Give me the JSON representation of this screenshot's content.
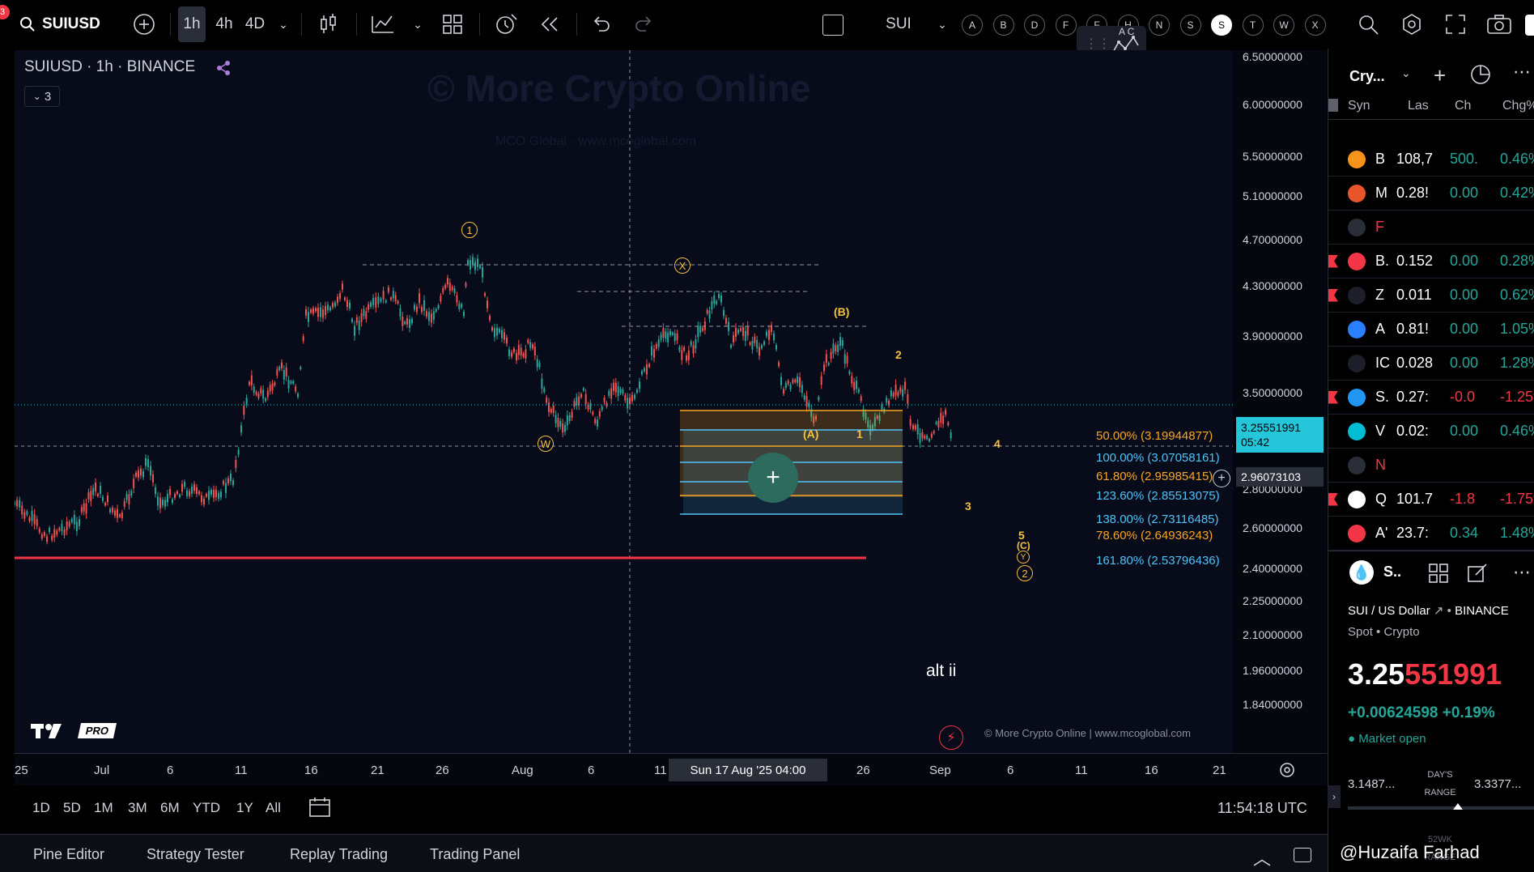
{
  "toolbar": {
    "notification_count": "3",
    "symbol": "SUIUSD",
    "timeframes": [
      "1h",
      "4h",
      "4D"
    ],
    "active_timeframe": "1h",
    "symbol_compare": "SUI",
    "letters": [
      "A",
      "B",
      "D",
      "F",
      "F",
      "H",
      "N",
      "S",
      "S",
      "T",
      "W",
      "X"
    ],
    "active_letter_index": 8,
    "drawing_overlay": "A C"
  },
  "chart": {
    "title": "SUIUSD · 1h · BINANCE",
    "indicators_count": "3",
    "watermark_main": "© More Crypto Online",
    "watermark_sub": "MCO Global   ·   www.mcoglobal.com",
    "footer_credit": "© More Crypto Online  |  www.mcoglobal.com",
    "alt_label": "alt ii",
    "logo_text": "PRO",
    "annotations": {
      "w1": "1",
      "wx": "X",
      "wb": "(B)",
      "w2": "2",
      "ww": "W",
      "wa": "(A)",
      "n1": "1",
      "n4": "4",
      "n3": "3",
      "n5": "5",
      "wc": "(C)",
      "wy": "Y",
      "w2b": "2"
    },
    "fib_levels": [
      {
        "label": "50.00% (3.19944877)",
        "color": "#f5a623"
      },
      {
        "label": "100.00% (3.07058161)",
        "color": "#4fc3f7"
      },
      {
        "label": "61.80% (2.95985415)",
        "color": "#f5a623"
      },
      {
        "label": "123.60% (2.85513075)",
        "color": "#4fc3f7"
      },
      {
        "label": "138.00% (2.73116485)",
        "color": "#4fc3f7"
      },
      {
        "label": "78.60% (2.64936243)",
        "color": "#f5a623"
      },
      {
        "label": "161.80% (2.53796436)",
        "color": "#4fc3f7"
      }
    ]
  },
  "price_axis": {
    "labels": [
      "6.50000000",
      "6.00000000",
      "5.50000000",
      "5.10000000",
      "4.70000000",
      "4.30000000",
      "3.90000000",
      "3.50000000",
      "2.80000000",
      "2.60000000",
      "2.40000000",
      "2.25000000",
      "2.10000000",
      "1.96000000",
      "1.84000000"
    ],
    "current_price": "3.25551991",
    "countdown": "05:42",
    "crosshair_price": "2.96073103"
  },
  "time_axis": {
    "labels": [
      "25",
      "Jul",
      "6",
      "11",
      "16",
      "21",
      "26",
      "Aug",
      "6",
      "11",
      "26",
      "Sep",
      "6",
      "11",
      "16",
      "21"
    ],
    "crosshair_time": "Sun 17 Aug '25   04:00"
  },
  "range_bar": {
    "ranges": [
      "1D",
      "5D",
      "1M",
      "3M",
      "6M",
      "YTD",
      "1Y",
      "All"
    ],
    "clock": "11:54:18 UTC"
  },
  "bottom_tabs": [
    "Pine Editor",
    "Strategy Tester",
    "Replay Trading",
    "Trading Panel"
  ],
  "watchlist": {
    "title": "Cry...",
    "columns": [
      "Syn",
      "Las",
      "Ch",
      "Chg%"
    ],
    "rows": [
      {
        "sym": "B",
        "last": "108,7",
        "chg": "500.",
        "pct": "0.46%",
        "icon_color": "#f7931a",
        "flag": false,
        "chg_color": "#26a69a"
      },
      {
        "sym": "M",
        "last": "0.28!",
        "chg": "0.00",
        "pct": "0.42%",
        "icon_color": "#e8552a",
        "flag": false,
        "chg_color": "#26a69a"
      },
      {
        "sym": "F",
        "last": "",
        "chg": "",
        "pct": "",
        "icon_color": "#2a2e39",
        "flag": false,
        "chg_color": "#f23645"
      },
      {
        "sym": "B.",
        "last": "0.152",
        "chg": "0.00",
        "pct": "0.28%",
        "icon_color": "#f23645",
        "flag": true,
        "chg_color": "#26a69a"
      },
      {
        "sym": "Z",
        "last": "0.011",
        "chg": "0.00",
        "pct": "0.62%",
        "icon_color": "#1c1f29",
        "flag": true,
        "chg_color": "#26a69a"
      },
      {
        "sym": "A",
        "last": "0.81!",
        "chg": "0.00",
        "pct": "1.05%",
        "icon_color": "#2a7fff",
        "flag": false,
        "chg_color": "#26a69a"
      },
      {
        "sym": "IC",
        "last": "0.028",
        "chg": "0.00",
        "pct": "1.28%",
        "icon_color": "#1c1f29",
        "flag": false,
        "chg_color": "#26a69a"
      },
      {
        "sym": "S.",
        "last": "0.27:",
        "chg": "-0.0",
        "pct": "-1.25%",
        "icon_color": "#2196f3",
        "flag": true,
        "chg_color": "#f23645"
      },
      {
        "sym": "V",
        "last": "0.02:",
        "chg": "0.00",
        "pct": "0.46%",
        "icon_color": "#00bcd4",
        "flag": false,
        "chg_color": "#26a69a"
      },
      {
        "sym": "N",
        "last": "",
        "chg": "",
        "pct": "",
        "icon_color": "#2a2e39",
        "flag": false,
        "chg_color": "#f23645"
      },
      {
        "sym": "Q",
        "last": "101.7",
        "chg": "-1.8",
        "pct": "-1.75%",
        "icon_color": "#ffffff",
        "flag": true,
        "chg_color": "#f23645"
      },
      {
        "sym": "A'",
        "last": "23.7:",
        "chg": "0.34",
        "pct": "1.48%",
        "icon_color": "#f23645",
        "flag": false,
        "chg_color": "#26a69a"
      }
    ]
  },
  "details": {
    "symbol_short": "S..",
    "name": "SUI / US Dollar",
    "exchange": "BINANCE",
    "type": "Spot • Crypto",
    "price_main": "3.25",
    "price_tail": "551991",
    "change": "+0.00624598",
    "change_pct": "+0.19%",
    "market_status": "Market open",
    "range_low": "3.1487...",
    "range_label": "DAY'S RANGE",
    "range_high": "3.3377...",
    "week52_label": "52WK RANGE",
    "watermark_user": "@Huzaifa Farhad"
  }
}
